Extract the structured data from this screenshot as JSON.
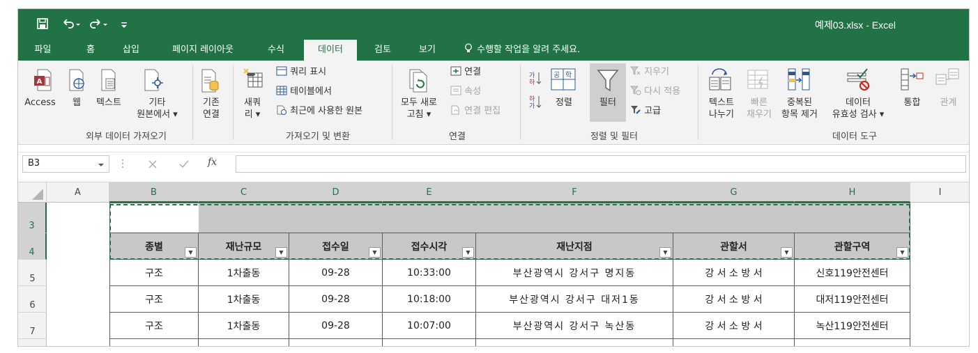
{
  "window": {
    "title": "예제03.xlsx - Excel"
  },
  "quick_access": {
    "save_icon": "save-icon",
    "undo_icon": "undo-icon",
    "redo_icon": "redo-icon",
    "customize_icon": "customize-qat-icon"
  },
  "tabs": [
    "파일",
    "홈",
    "삽입",
    "페이지 레이아웃",
    "수식",
    "데이터",
    "검토",
    "보기"
  ],
  "active_tab": "데이터",
  "tell_me": "수행할 작업을 알려 주세요.",
  "ribbon": {
    "external": {
      "access": "Access",
      "web": "웹",
      "text": "텍스트",
      "other_1": "기타",
      "other_2": "원본에서 ▾",
      "group": "외부 데이터 가져오기"
    },
    "existing": {
      "line1": "기존",
      "line2": "연결"
    },
    "transform": {
      "new_query_1": "새쿼",
      "new_query_2": "리 ▾",
      "show_queries": "쿼리 표시",
      "from_table": "테이블에서",
      "recent_sources": "최근에 사용한 원본",
      "group": "가져오기 및 변환"
    },
    "connections": {
      "refresh_1": "모두 새로",
      "refresh_2": "고침 ▾",
      "connections": "연결",
      "properties": "속성",
      "edit_links": "연결 편집",
      "group": "연결"
    },
    "sort_filter": {
      "sort": "정렬",
      "filter": "필터",
      "clear": "지우기",
      "reapply": "다시 적용",
      "advanced": "고급",
      "group": "정렬 및 필터"
    },
    "data_tools": {
      "text_to_col_1": "텍스트",
      "text_to_col_2": "나누기",
      "flash_fill_1": "빠른",
      "flash_fill_2": "채우기",
      "remove_dup_1": "중복된",
      "remove_dup_2": "항목 제거",
      "validation_1": "데이터",
      "validation_2": "유효성 검사 ▾",
      "consolidate": "통합",
      "relationships": "관계",
      "group": "데이터 도구"
    }
  },
  "formula_bar": {
    "name_box": "B3",
    "fx_label": "fx",
    "formula": ""
  },
  "columns": [
    "A",
    "B",
    "C",
    "D",
    "E",
    "F",
    "G",
    "H",
    "I"
  ],
  "rows": [
    "3",
    "4",
    "5",
    "6",
    "7"
  ],
  "table": {
    "headers": [
      "종별",
      "재난규모",
      "접수일",
      "접수시각",
      "재난지점",
      "관할서",
      "관할구역"
    ],
    "rows": [
      [
        "구조",
        "1차출동",
        "09-28",
        "10:33:00",
        "부산광역시 강서구 명지동",
        "강 서 소 방 서",
        "신호119안전센터"
      ],
      [
        "구조",
        "1차출동",
        "09-28",
        "10:18:00",
        "부산광역시 강서구 대저1동",
        "강 서 소 방 서",
        "대저119안전센터"
      ],
      [
        "구조",
        "1차출동",
        "09-28",
        "10:07:00",
        "부산광역시 강서구 녹산동",
        "강 서 소 방 서",
        "녹산119안전센터"
      ]
    ]
  }
}
